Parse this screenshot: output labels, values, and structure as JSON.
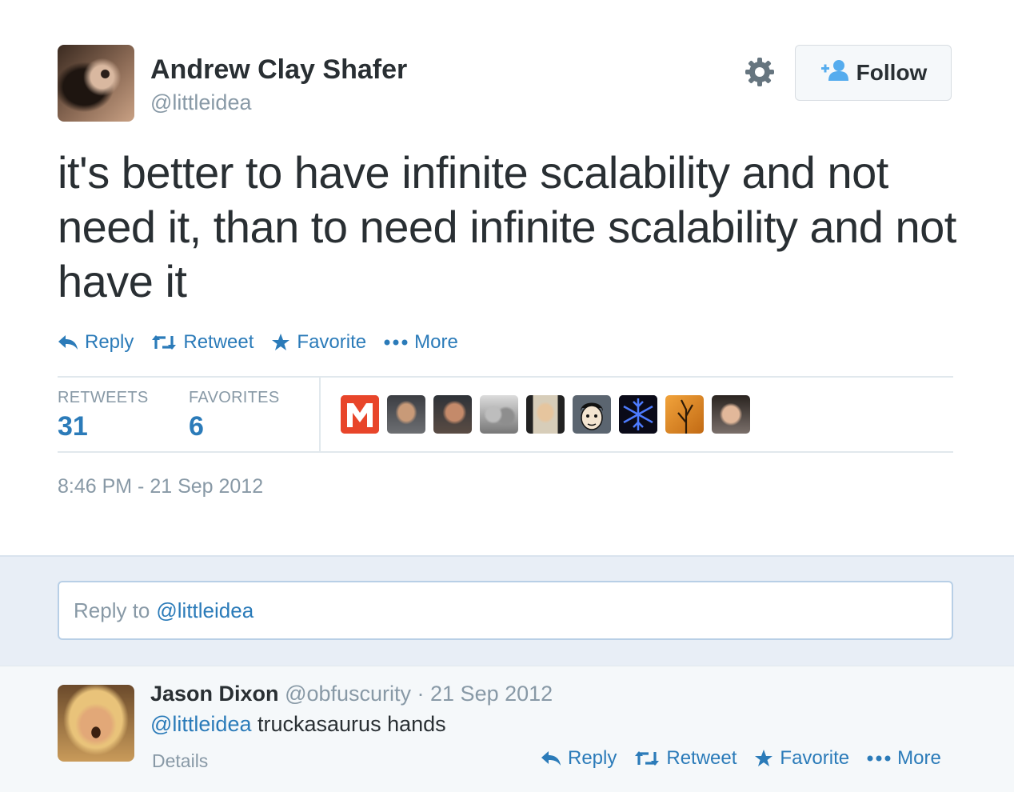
{
  "tweet": {
    "author_name": "Andrew Clay Shafer",
    "author_handle": "@littleidea",
    "text": "it's better to have infinite scalability and not need it, than to need infinite scalability and not have it",
    "timestamp": "8:46 PM - 21 Sep 2012"
  },
  "header": {
    "settings_icon": "gear-icon",
    "follow_label": "Follow"
  },
  "actions": {
    "reply": "Reply",
    "retweet": "Retweet",
    "favorite": "Favorite",
    "more": "More"
  },
  "stats": {
    "retweets_label": "RETWEETS",
    "retweets_count": "31",
    "favorites_label": "FAVORITES",
    "favorites_count": "6"
  },
  "reply_box": {
    "prefix": "Reply to",
    "mention": "@littleidea"
  },
  "reply": {
    "author_name": "Jason Dixon",
    "meta": "@obfuscurity · 21 Sep 2012",
    "mention": "@littleidea",
    "text": "truckasaurus hands",
    "details_label": "Details"
  },
  "colors": {
    "link": "#2b7bb9",
    "muted": "#8899a6",
    "text": "#292f33",
    "reply_bg": "#e8eef6"
  }
}
